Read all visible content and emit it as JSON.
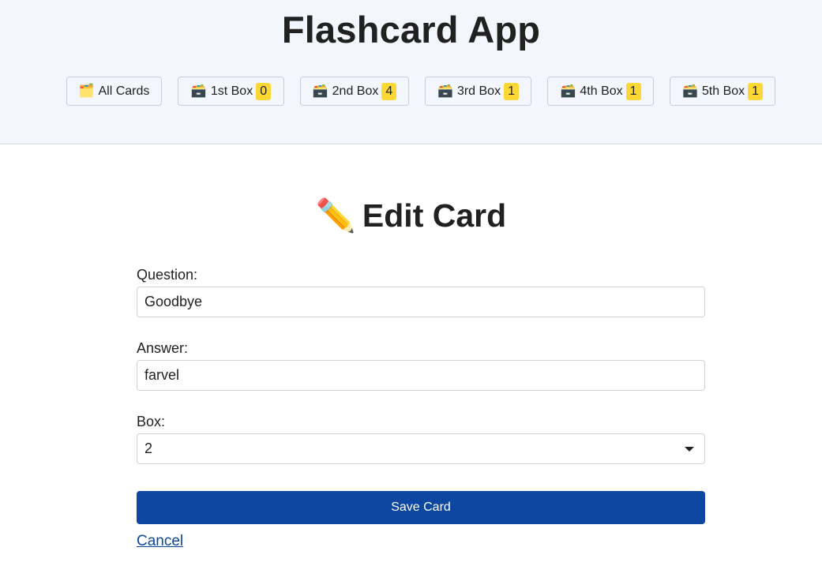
{
  "header": {
    "title": "Flashcard App",
    "nav": [
      {
        "icon": "🗂️",
        "icon_name": "folder-icon",
        "label": "All Cards",
        "count": null
      },
      {
        "icon": "🗃️",
        "icon_name": "card-box-icon",
        "label": "1st Box",
        "count": "0"
      },
      {
        "icon": "🗃️",
        "icon_name": "card-box-icon",
        "label": "2nd Box",
        "count": "4"
      },
      {
        "icon": "🗃️",
        "icon_name": "card-box-icon",
        "label": "3rd Box",
        "count": "1"
      },
      {
        "icon": "🗃️",
        "icon_name": "card-box-icon",
        "label": "4th Box",
        "count": "1"
      },
      {
        "icon": "🗃️",
        "icon_name": "card-box-icon",
        "label": "5th Box",
        "count": "1"
      }
    ]
  },
  "form": {
    "heading_icon": "✏️",
    "heading_icon_name": "pencil-icon",
    "heading": "Edit Card",
    "question_label": "Question:",
    "question_value": "Goodbye",
    "answer_label": "Answer:",
    "answer_value": "farvel",
    "box_label": "Box:",
    "box_value": "2",
    "save_label": "Save Card",
    "cancel_label": "Cancel"
  },
  "colors": {
    "header_bg": "#f3f6fd",
    "badge": "#fdd835",
    "primary": "#0d47a1"
  }
}
